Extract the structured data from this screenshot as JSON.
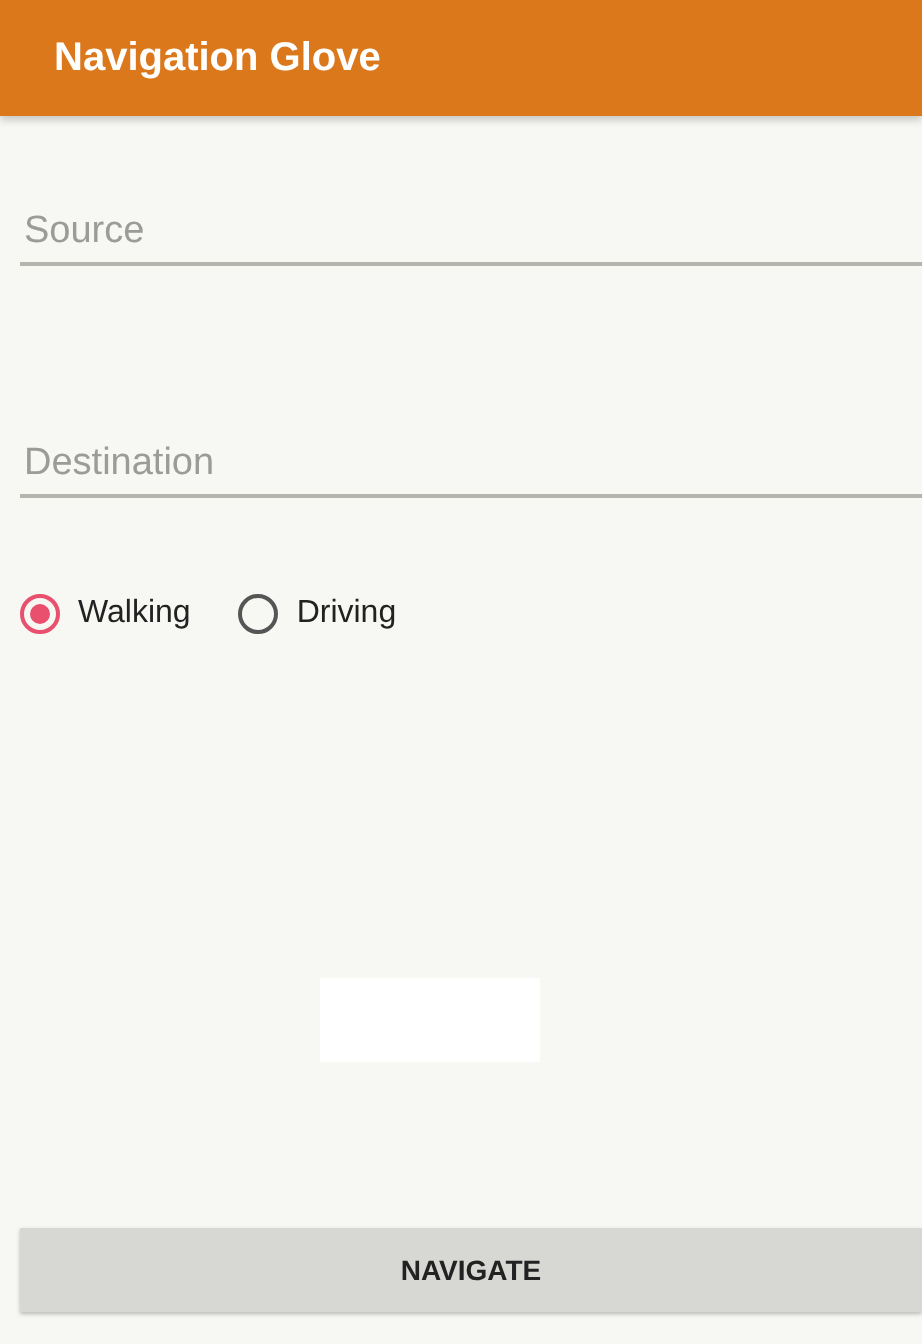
{
  "app_bar": {
    "title": "Navigation Glove"
  },
  "fields": [
    {
      "placeholder": "Source"
    },
    {
      "placeholder": "Destination"
    }
  ],
  "modes": [
    {
      "label": "Walking",
      "selected": true
    },
    {
      "label": "Driving",
      "selected": false
    }
  ],
  "buttons": [
    "NAVIGATE"
  ]
}
